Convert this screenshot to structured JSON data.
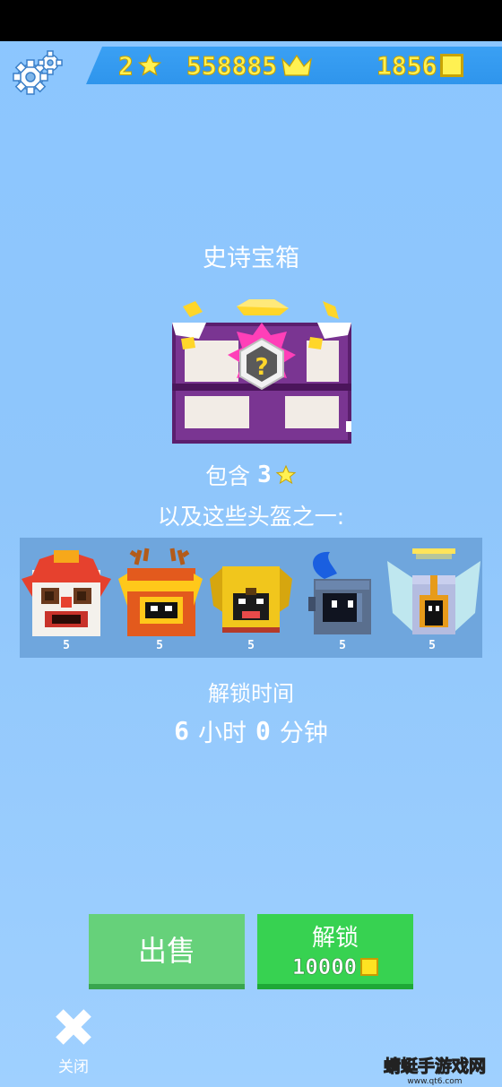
{
  "topbar": {
    "stars": "2",
    "crowns": "558885",
    "coins": "1856"
  },
  "chest": {
    "title": "史诗宝箱",
    "contains_prefix": "包含",
    "contains_count": "3",
    "helmets_label": "以及这些头盔之一:"
  },
  "helmets": [
    {
      "name": "lion-dance-helmet",
      "level": "5"
    },
    {
      "name": "dragon-helmet",
      "level": "5"
    },
    {
      "name": "dog-helmet",
      "level": "5"
    },
    {
      "name": "knight-helmet",
      "level": "5"
    },
    {
      "name": "angel-helmet",
      "level": "5"
    }
  ],
  "unlock": {
    "time_label": "解锁时间",
    "hours": "6",
    "hours_unit": "小时",
    "minutes": "0",
    "minutes_unit": "分钟"
  },
  "buttons": {
    "sell": "出售",
    "unlock": "解锁",
    "unlock_cost": "10000",
    "close": "关闭"
  },
  "watermark": {
    "text": "蜻蜓手游戏网",
    "url": "www.qt6.com"
  },
  "colors": {
    "background": "#8fc6fb",
    "topbar": "#3aa0f4",
    "currency_yellow": "#fff152",
    "sell_button": "#66d17a",
    "unlock_button": "#37d251",
    "chest_purple": "#6a2a7e",
    "chest_pink": "#ff3fb8"
  }
}
